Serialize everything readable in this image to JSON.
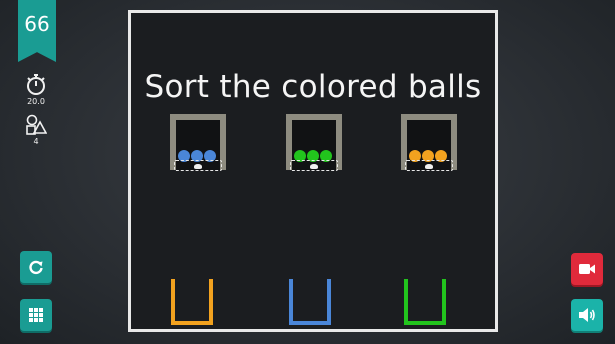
{
  "level": "66",
  "stats": {
    "timer": {
      "icon": "stopwatch-icon",
      "value": "20.0"
    },
    "shapes": {
      "icon": "shapes-icon",
      "value": "4"
    }
  },
  "title": "Sort the colored balls",
  "colors": {
    "accent": "#1a9c93",
    "blue": "#4a86d8",
    "green": "#22c41d",
    "orange": "#f2a21f",
    "record": "#e02a3b",
    "board_border": "#e9e9e9"
  },
  "buttons": {
    "restart": {
      "icon": "restart-icon"
    },
    "menu": {
      "icon": "grid-menu-icon"
    },
    "record": {
      "icon": "video-camera-icon"
    },
    "sound": {
      "icon": "speaker-icon"
    }
  },
  "holders": [
    {
      "color": "blue",
      "balls": 3
    },
    {
      "color": "green",
      "balls": 3
    },
    {
      "color": "orange",
      "balls": 3
    }
  ],
  "cups": [
    {
      "color": "orange"
    },
    {
      "color": "blue"
    },
    {
      "color": "green"
    }
  ]
}
